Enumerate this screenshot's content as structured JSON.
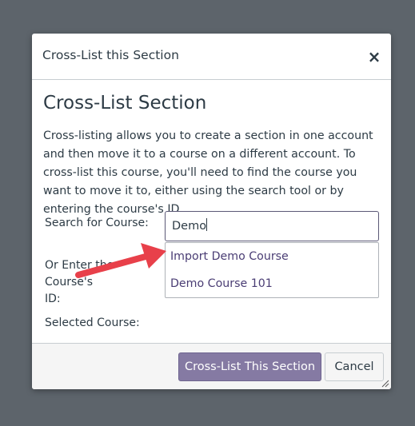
{
  "dialog": {
    "title": "Cross-List this Section",
    "close_symbol": "×"
  },
  "content": {
    "heading": "Cross-List Section",
    "description": "Cross-listing allows you to create a section in one account and then move it to a course on a different account. To cross-list this course, you'll need to find the course you want to move it to, either using the search tool or by entering the course's ID.",
    "search_label": "Search for Course:",
    "search_value": "Demo",
    "enter_id_label_line1": "Or Enter the Course's",
    "enter_id_label_line2": "ID:",
    "selected_course_label": "Selected Course:",
    "results": [
      {
        "label": "Import Demo Course"
      },
      {
        "label": "Demo Course 101"
      }
    ]
  },
  "footer": {
    "submit_label": "Cross-List This Section",
    "cancel_label": "Cancel"
  },
  "colors": {
    "overlay": "#5d646b",
    "primary_button": "#857aa3",
    "link_purple": "#4a3d74",
    "annotation_arrow": "#e8404a"
  },
  "icons": {
    "close": "close-icon",
    "resize": "resize-handle-icon",
    "annotation": "annotation-arrow"
  }
}
